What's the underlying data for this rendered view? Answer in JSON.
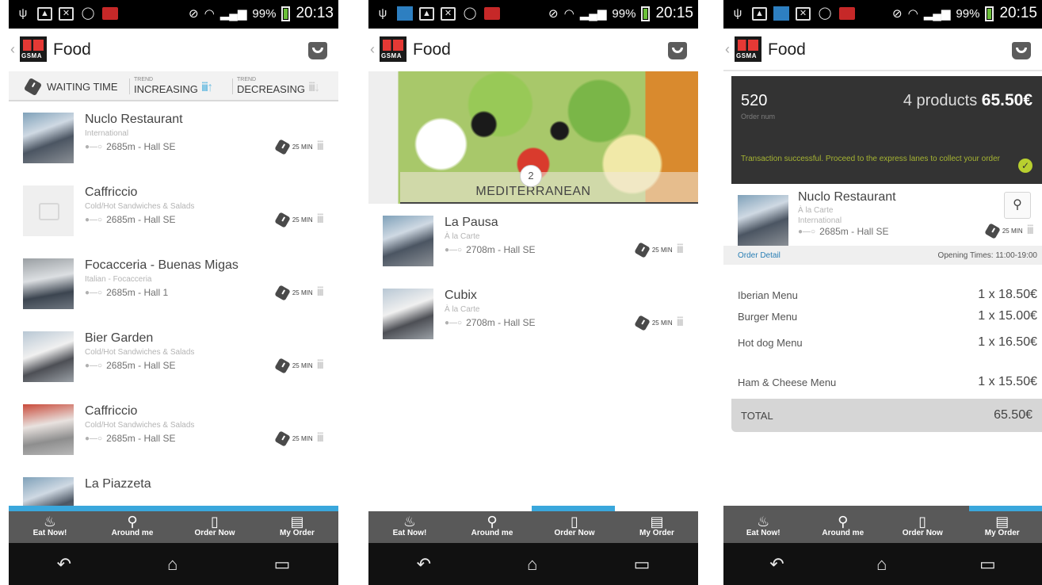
{
  "screens": [
    {
      "status": {
        "battery": "99%",
        "time": "20:13"
      },
      "header": {
        "logo_text": "GSMA",
        "title": "Food"
      },
      "legend": {
        "waiting_label": "WAITING TIME",
        "trend_small": "TREND",
        "increasing": "INCREASING",
        "decreasing": "DECREASING"
      },
      "items": [
        {
          "name": "Nuclo Restaurant",
          "category": "International",
          "location": "2685m - Hall SE",
          "wait": "25 MIN"
        },
        {
          "name": "Caffriccio",
          "category": "Cold/Hot Sandwiches & Salads",
          "location": "2685m - Hall SE",
          "wait": "25 MIN"
        },
        {
          "name": "Focacceria - Buenas Migas",
          "category": "Italian - Focacceria",
          "location": "2685m - Hall 1",
          "wait": "25 MIN"
        },
        {
          "name": "Bier Garden",
          "category": "Cold/Hot Sandwiches & Salads",
          "location": "2685m - Hall SE",
          "wait": "25 MIN"
        },
        {
          "name": "Caffriccio",
          "category": "Cold/Hot Sandwiches & Salads",
          "location": "2685m - Hall SE",
          "wait": "25 MIN"
        },
        {
          "name": "La Piazzeta"
        }
      ],
      "active_tab": 0
    },
    {
      "status": {
        "battery": "99%",
        "time": "20:15"
      },
      "header": {
        "logo_text": "GSMA",
        "title": "Food"
      },
      "hero": {
        "count": "2",
        "label": "MEDITERRANEAN"
      },
      "items": [
        {
          "name": "La Pausa",
          "category": "À la Carte",
          "location": "2708m - Hall SE",
          "wait": "25 MIN"
        },
        {
          "name": "Cubix",
          "category": "À la Carte",
          "location": "2708m - Hall SE",
          "wait": "25 MIN"
        }
      ],
      "active_tab": 2
    },
    {
      "status": {
        "battery": "99%",
        "time": "20:15"
      },
      "header": {
        "logo_text": "GSMA",
        "title": "Food"
      },
      "order": {
        "number": "520",
        "number_label": "Order num",
        "products": "4 products",
        "total": "65.50€",
        "message": "Transaction successful. Proceed to the express lanes to collect your order"
      },
      "restaurant": {
        "name": "Nuclo Restaurant",
        "category1": "À la Carte",
        "category2": "International",
        "location": "2685m - Hall SE",
        "wait": "25 MIN"
      },
      "detail": {
        "title": "Order Detail",
        "opening": "Opening Times: 11:00-19:00",
        "lines": [
          {
            "name": "Iberian Menu",
            "qty": "1 x 18.50€"
          },
          {
            "name": "Burger Menu",
            "qty": "1 x 15.00€"
          },
          {
            "name": "Hot dog Menu",
            "qty": "1 x 16.50€"
          },
          {
            "name": "Ham & Cheese Menu",
            "qty": "1 x 15.50€"
          }
        ],
        "total_label": "TOTAL",
        "total_value": "65.50€"
      },
      "active_tab": 3
    }
  ],
  "tabs": [
    {
      "label": "Eat Now!",
      "icon": "bowl-icon"
    },
    {
      "label": "Around me",
      "icon": "location-fork-icon"
    },
    {
      "label": "Order Now",
      "icon": "door-icon"
    },
    {
      "label": "My Order",
      "icon": "receipt-icon"
    }
  ],
  "colors": {
    "accent": "#3aa7dc",
    "tabbar": "#595959",
    "order_card": "#333333",
    "success": "#b8cf2f"
  }
}
